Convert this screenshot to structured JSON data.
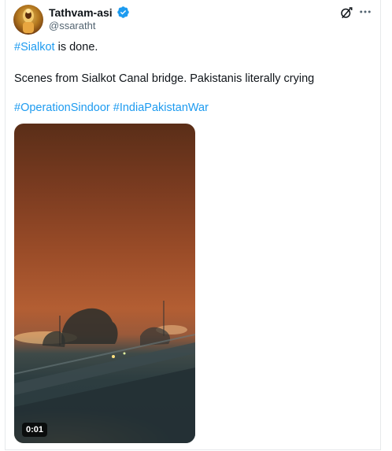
{
  "author": {
    "display_name": "Tathvam-asi",
    "handle": "@ssaratht",
    "verified": true
  },
  "tweet": {
    "line1_hashtag": "#Sialkot",
    "line1_rest": " is done.",
    "line2": "Scenes from Sialkot Canal bridge. Pakistanis literally crying",
    "hashtag1": "#OperationSindoor",
    "hashtag2": "#IndiaPakistanWar"
  },
  "media": {
    "duration": "0:01"
  },
  "icons": {
    "grok": "grok-icon",
    "more": "more-dots-icon",
    "verified": "verified-badge-icon"
  },
  "colors": {
    "link": "#1d9bf0",
    "text": "#0f1419",
    "secondary": "#536471"
  }
}
